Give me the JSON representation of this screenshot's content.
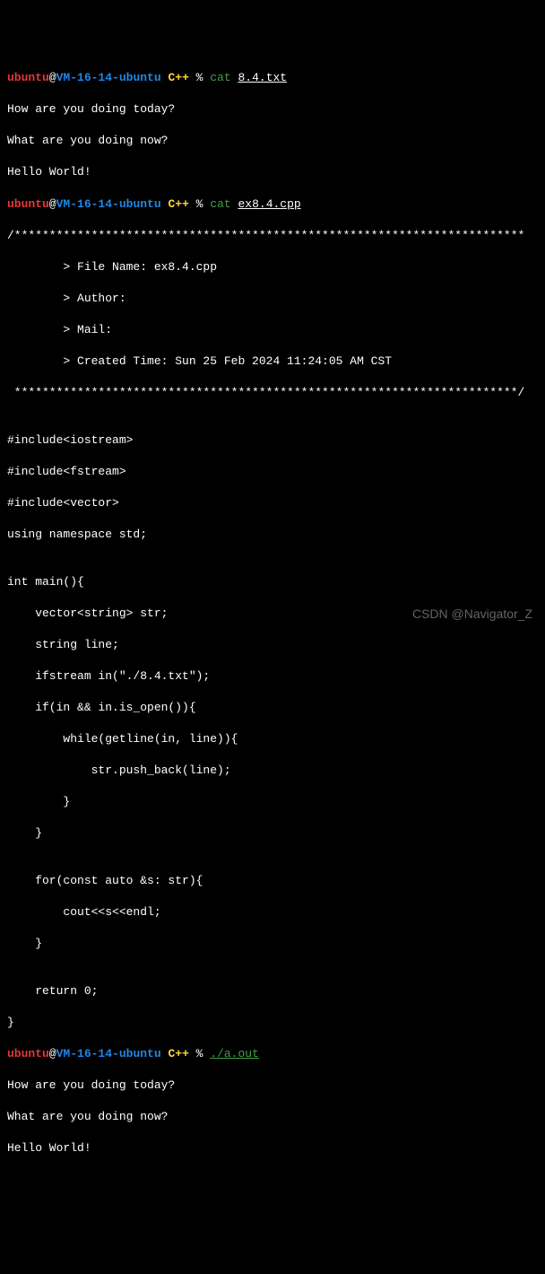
{
  "prompt": {
    "user": "ubuntu",
    "at": "@",
    "host": "VM-16-14-ubuntu",
    "path": "C++",
    "sep": " % "
  },
  "cmd1": {
    "cmd": "cat",
    "arg": "8.4.txt"
  },
  "out1": {
    "l1": "How are you doing today?",
    "l2": "What are you doing now?",
    "l3": "Hello World!"
  },
  "cmd2": {
    "cmd": "cat",
    "arg": "ex8.4.cpp"
  },
  "src": {
    "l0": "/*************************************************************************",
    "l1": "        > File Name: ex8.4.cpp",
    "l2": "        > Author:",
    "l3": "        > Mail:",
    "l4": "        > Created Time: Sun 25 Feb 2024 11:24:05 AM CST",
    "l5": " ************************************************************************/",
    "l6": "",
    "l7": "#include<iostream>",
    "l8": "#include<fstream>",
    "l9": "#include<vector>",
    "l10": "using namespace std;",
    "l11": "",
    "l12": "int main(){",
    "l13": "    vector<string> str;",
    "l14": "    string line;",
    "l15": "    ifstream in(\"./8.4.txt\");",
    "l16": "    if(in && in.is_open()){",
    "l17": "        while(getline(in, line)){",
    "l18": "            str.push_back(line);",
    "l19": "        }",
    "l20": "    }",
    "l21": "",
    "l22": "    for(const auto &s: str){",
    "l23": "        cout<<s<<endl;",
    "l24": "    }",
    "l25": "",
    "l26": "    return 0;",
    "l27": "}"
  },
  "cmd3": {
    "cmd": "",
    "arg": "./a.out"
  },
  "out3": {
    "l1": "How are you doing today?",
    "l2": "What are you doing now?",
    "l3": "Hello World!"
  },
  "watermark": "CSDN @Navigator_Z"
}
